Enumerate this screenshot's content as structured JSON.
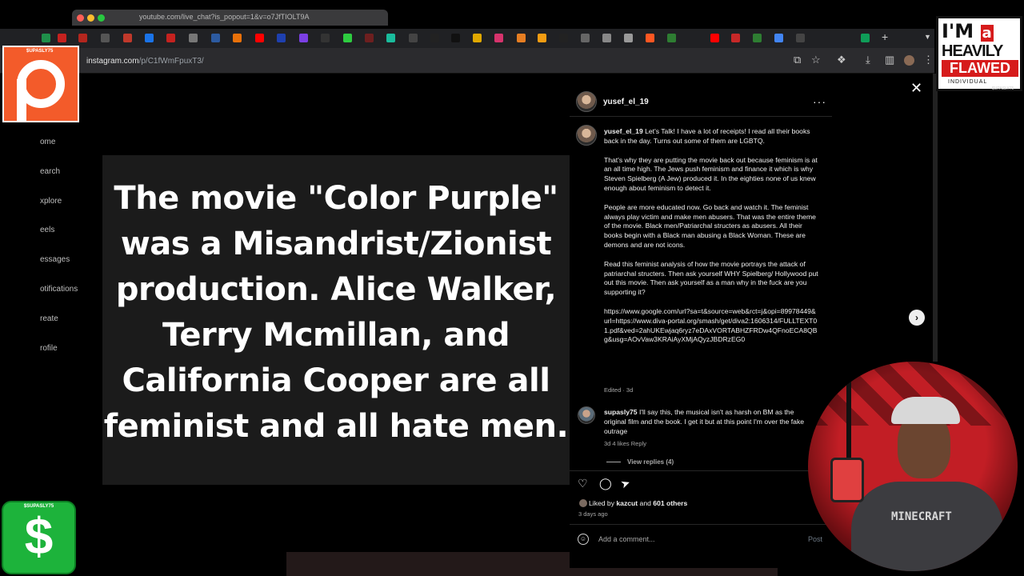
{
  "popout": {
    "url": "youtube.com/live_chat?is_popout=1&v=o7JfTIOLT9A"
  },
  "address": {
    "domain": "instagram.com",
    "path": "/p/C1fWmFpuxT3/"
  },
  "overlays": {
    "patreon_caption": "$UPASLY75",
    "cashapp_caption": "$SUPASLY75",
    "cashapp_symbol": "$",
    "flawed_line1": "I'M",
    "flawed_a": "a",
    "flawed_line2": "HEAVILY",
    "flawed_line3": "FLAWED",
    "flawed_line4": "INDIVIDUAL",
    "flawed_credit": "$UPASLY75"
  },
  "nav": [
    "ome",
    "earch",
    "xplore",
    "eels",
    "essages",
    "otifications",
    "reate",
    "rofile"
  ],
  "post": {
    "image_text": "The movie \"Color Purple\" was a Misandrist/Zionist production. Alice Walker, Terry Mcmillan,  and California Cooper are all feminist and all hate men."
  },
  "panel": {
    "username": "yusef_el_19",
    "caption_user": "yusef_el_19",
    "caption_p1": "Let's Talk! I have a lot of receipts! I read all their books back in the day. Turns out some of them are LGBTQ.",
    "caption_p2": "That's why they are putting the movie back out because feminism is at an all time high. The Jews push feminism and finance it which is why Steven Spielberg (A Jew) produced it. In the eighties none of us knew enough about feminism to detect it.",
    "caption_p3": "People are more educated now. Go back and watch it. The feminist always play victim and make men abusers. That was the entire theme of the movie. Black men/Patriarchal structers as abusers. All their books begin with a Black man abusing a Black Woman. These are demons and are not icons.",
    "caption_p4": "Read this feminist analysis of how the movie portrays the attack of patriarchal structers. Then ask yourself WHY Spielberg/ Hollywood put out this movie. Then ask yourself as a man why in the fuck are you supporting it?",
    "caption_link": "https://www.google.com/url?sa=t&source=web&rct=j&opi=89978449&url=https://www.diva-portal.org/smash/get/diva2:1606314/FULLTEXT01.pdf&ved=2ahUKEwjaq6ryz7eDAxVORTABHZFRDw4QFnoECA8QBg&usg=AOvVaw3KRAiAyXMjAQyzJBDRzEG0",
    "caption_meta": "Edited · 3d",
    "reply_user": "supasly75",
    "reply_text": "I'll say this, the musical isn't as harsh on BM as the original film and the book. I get it but at this point I'm over the fake outrage",
    "reply_meta": "3d   4 likes   Reply",
    "view_replies": "View replies (4)",
    "liked_prefix": "Liked by",
    "liked_user": "kazcut",
    "liked_and": "and",
    "liked_others": "601 others",
    "days_ago": "3 days ago",
    "add_comment_placeholder": "Add a comment...",
    "post_label": "Post"
  },
  "webcam": {
    "shirt_text": "MINECRAFT"
  }
}
